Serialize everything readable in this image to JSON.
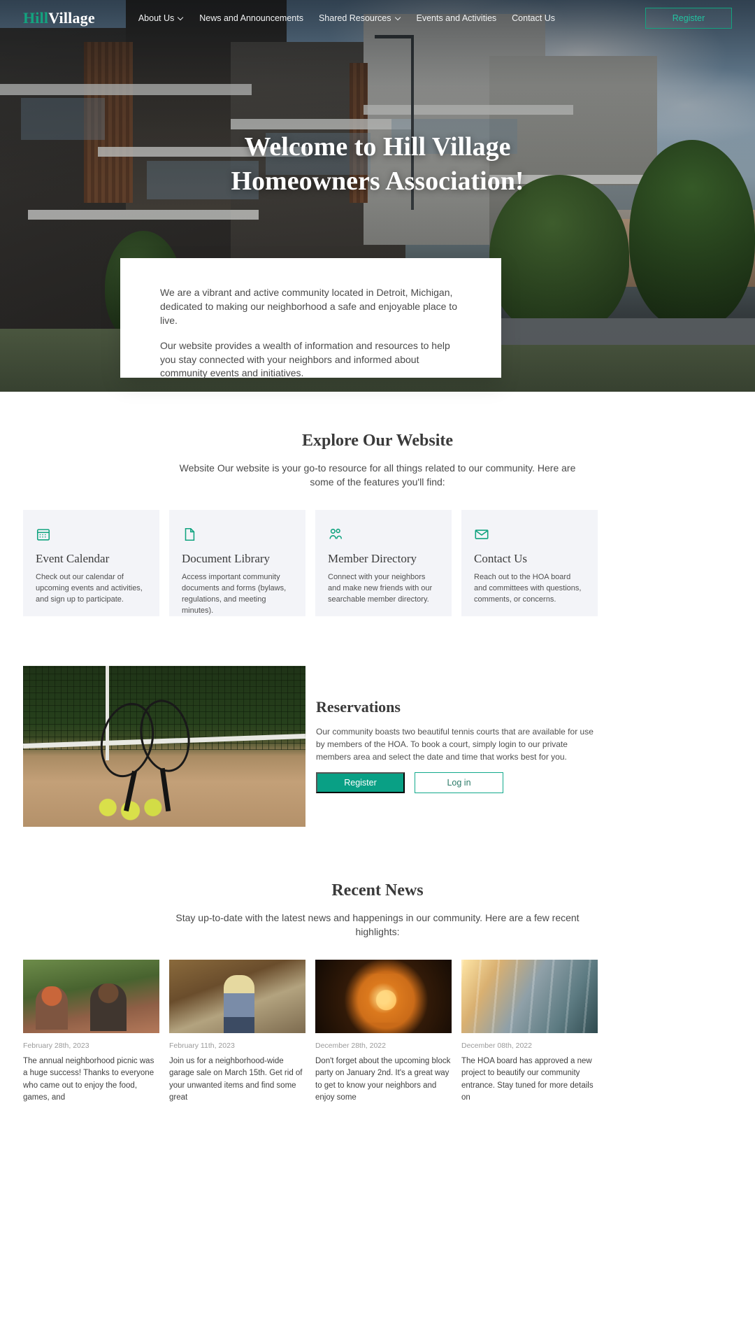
{
  "nav": {
    "logo_primary": "Hill",
    "logo_secondary": "Village",
    "links": [
      {
        "label": "About Us",
        "has_caret": true
      },
      {
        "label": "News and Announcements",
        "has_caret": false
      },
      {
        "label": "Shared Resources",
        "has_caret": true
      },
      {
        "label": "Events and Activities",
        "has_caret": false
      },
      {
        "label": "Contact Us",
        "has_caret": false
      }
    ],
    "register_label": "Register"
  },
  "hero": {
    "title_line1": "Welcome to Hill Village",
    "title_line2": "Homeowners Association!"
  },
  "intro": {
    "paragraph1": "We are a vibrant and active community located in Detroit, Michigan, dedicated to making our neighborhood a safe and enjoyable place to live.",
    "paragraph2": "Our website provides a wealth of information and resources to help you stay connected with your neighbors and informed about community events and initiatives."
  },
  "explore": {
    "title": "Explore Our Website",
    "subtitle": "Website Our website is your go-to resource for all things related to our community. Here are some of the features you'll find:",
    "cards": [
      {
        "icon": "calendar-icon",
        "title": "Event Calendar",
        "text": "Check out our calendar of upcoming events and activities, and sign up to participate."
      },
      {
        "icon": "document-icon",
        "title": "Document Library",
        "text": "Access important community documents and forms (bylaws, regulations, and meeting minutes)."
      },
      {
        "icon": "users-icon",
        "title": "Member Directory",
        "text": "Connect with your neighbors and make new friends with our searchable member directory."
      },
      {
        "icon": "envelope-icon",
        "title": "Contact Us",
        "text": "Reach out to the HOA board and committees with questions, comments, or concerns."
      }
    ]
  },
  "reservations": {
    "title": "Reservations",
    "text": "Our community boasts two beautiful tennis courts that are available for use by members of the HOA. To book a court, simply login to our private members area and select the date and time that works best for you.",
    "register_label": "Register",
    "login_label": "Log in"
  },
  "news": {
    "title": "Recent News",
    "subtitle": "Stay up-to-date with the latest news and happenings in our community. Here are a few recent highlights:",
    "items": [
      {
        "date": "February 28th, 2023",
        "text": "The annual neighborhood picnic was a huge success! Thanks to everyone who came out to enjoy the food, games, and"
      },
      {
        "date": "February 11th, 2023",
        "text": "Join us for a neighborhood-wide garage sale on March 15th. Get rid of your unwanted items and find some great"
      },
      {
        "date": "December 28th, 2022",
        "text": "Don't forget about the upcoming block party on January 2nd. It's a great way to get to know your neighbors and enjoy some"
      },
      {
        "date": "December 08th, 2022",
        "text": "The HOA board has approved a new project to beautify our community entrance. Stay tuned for more details on"
      }
    ]
  },
  "colors": {
    "accent_teal": "#13a37f",
    "button_teal": "#09a085",
    "card_bg": "#f3f4f8",
    "heading": "#3a3a3a"
  }
}
